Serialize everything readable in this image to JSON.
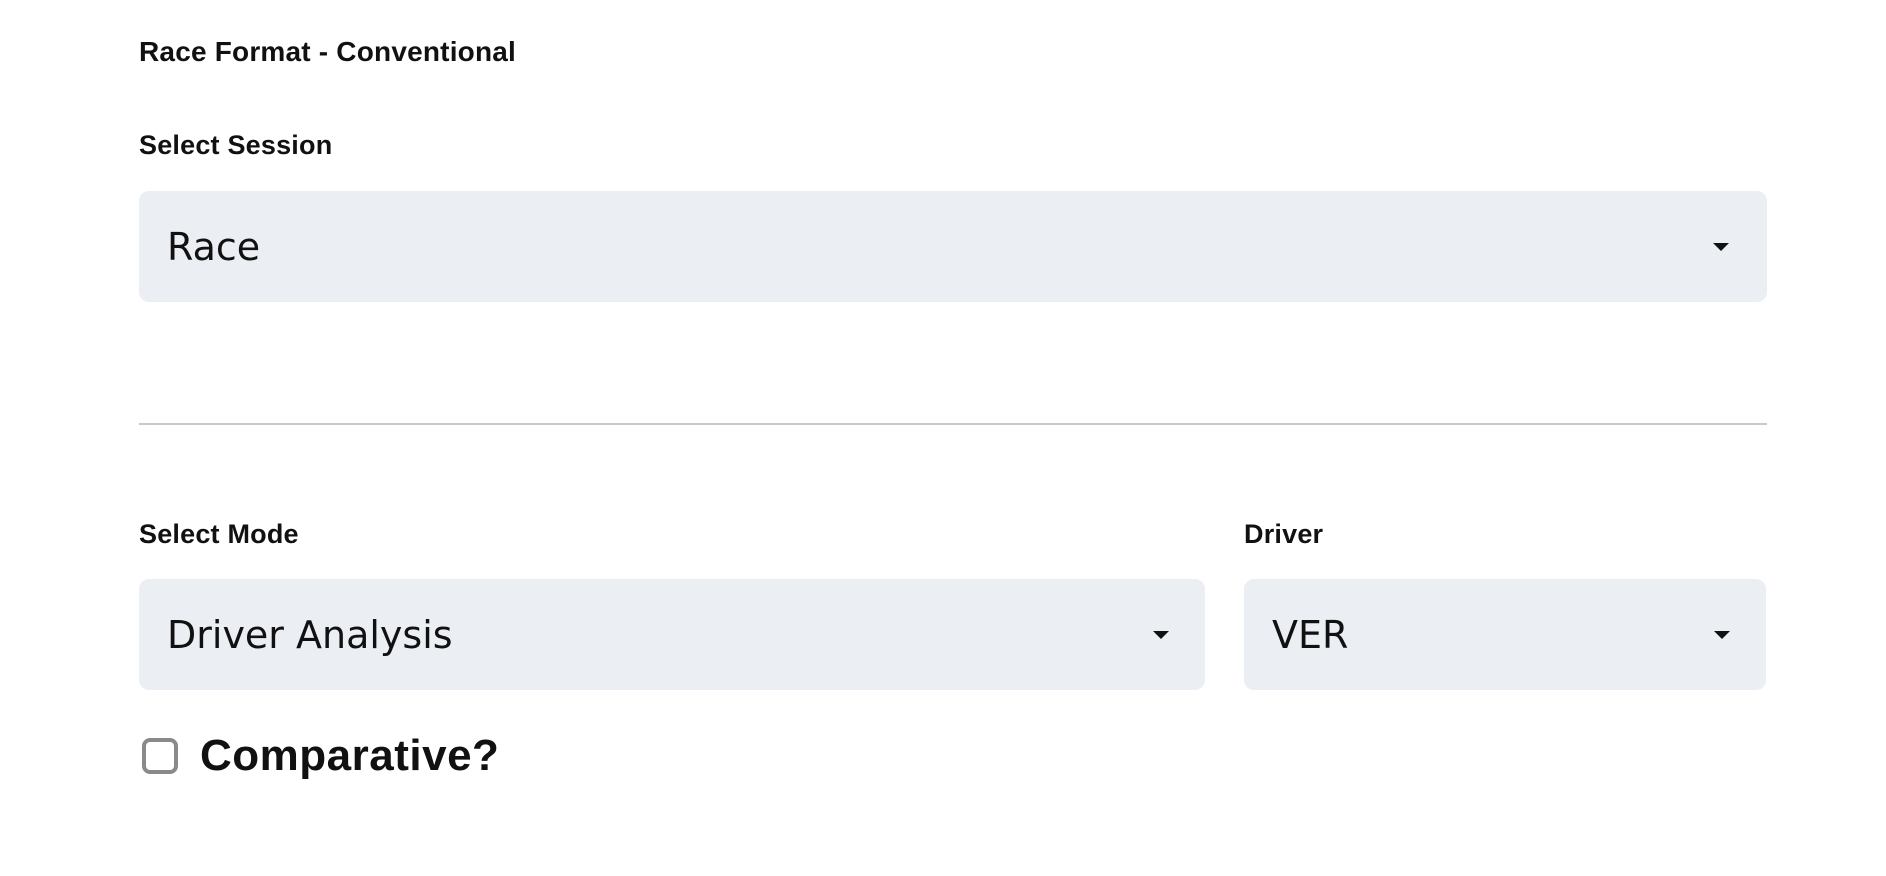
{
  "header": {
    "race_format": "Race Format - Conventional"
  },
  "session": {
    "label": "Select Session",
    "value": "Race"
  },
  "mode": {
    "label": "Select Mode",
    "value": "Driver Analysis"
  },
  "driver": {
    "label": "Driver",
    "value": "VER"
  },
  "comparative": {
    "label": "Comparative?",
    "checked": false
  },
  "colors": {
    "select_background": "#ebeef3",
    "divider": "#c9c9c9",
    "checkbox_border": "#8a8a8a",
    "text": "#111111"
  },
  "icons": {
    "select_caret": "caret-down-icon"
  }
}
